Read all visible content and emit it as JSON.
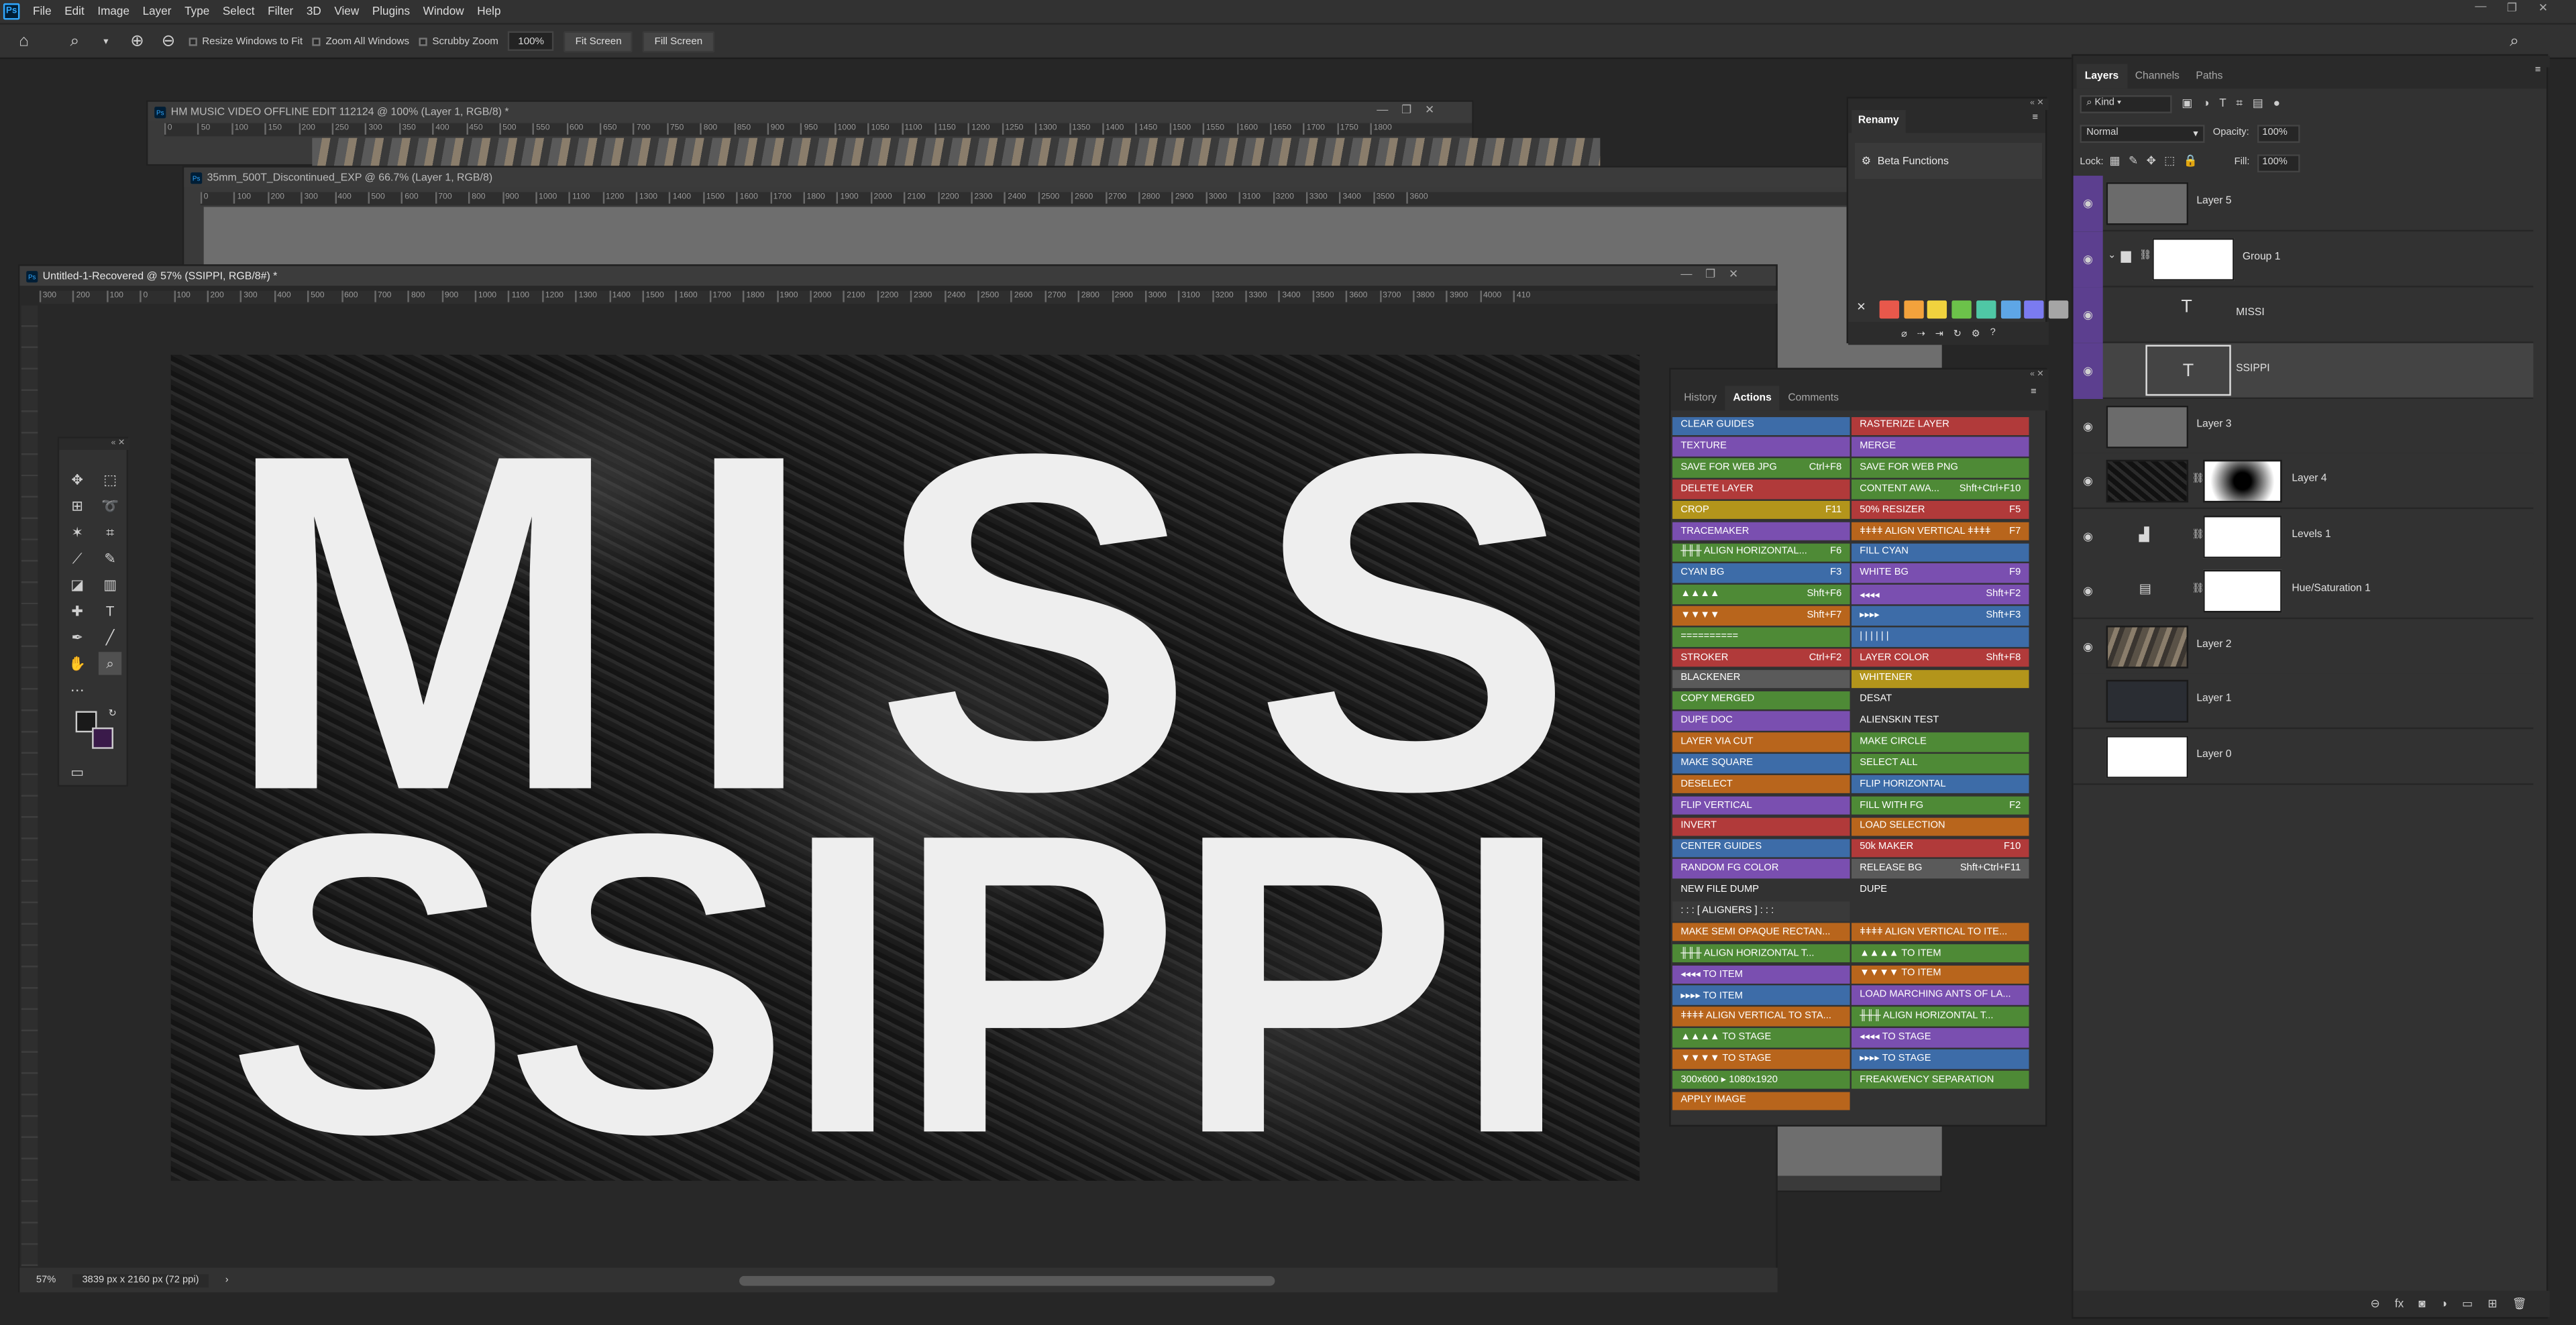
{
  "menubar": {
    "items": [
      "File",
      "Edit",
      "Image",
      "Layer",
      "Type",
      "Select",
      "Filter",
      "3D",
      "View",
      "Plugins",
      "Window",
      "Help"
    ]
  },
  "options": {
    "resize_windows": "Resize Windows to Fit",
    "zoom_all": "Zoom All Windows",
    "scrubby": "Scrubby Zoom",
    "zoom_value": "100%",
    "fit_screen": "Fit Screen",
    "fill_screen": "Fill Screen"
  },
  "docs": {
    "doc1_title": "HM MUSIC VIDEO OFFLINE EDIT 112124 @ 100% (Layer 1, RGB/8) *",
    "doc2_title": "35mm_500T_Discontinued_EXP @ 66.7% (Layer 1, RGB/8)",
    "doc3_title": "Untitled-1-Recovered @ 57% (SSIPPI, RGB/8#) *",
    "ruler1": [
      "0",
      "50",
      "100",
      "150",
      "200",
      "250",
      "300",
      "350",
      "400",
      "450",
      "500",
      "550",
      "600",
      "650",
      "700",
      "750",
      "800",
      "850",
      "900",
      "950",
      "1000",
      "1050",
      "1100",
      "1150",
      "1200",
      "1250",
      "1300",
      "1350",
      "1400",
      "1450",
      "1500",
      "1550",
      "1600",
      "1650",
      "1700",
      "1750",
      "1800"
    ],
    "ruler2": [
      "0",
      "100",
      "200",
      "300",
      "400",
      "500",
      "600",
      "700",
      "800",
      "900",
      "1000",
      "1100",
      "1200",
      "1300",
      "1400",
      "1500",
      "1600",
      "1700",
      "1800",
      "1900",
      "2000",
      "2100",
      "2200",
      "2300",
      "2400",
      "2500",
      "2600",
      "2700",
      "2800",
      "2900",
      "3000",
      "3100",
      "3200",
      "3300",
      "3400",
      "3500",
      "3600"
    ],
    "ruler3": [
      "300",
      "200",
      "100",
      "0",
      "100",
      "200",
      "300",
      "400",
      "500",
      "600",
      "700",
      "800",
      "900",
      "1000",
      "1100",
      "1200",
      "1300",
      "1400",
      "1500",
      "1600",
      "1700",
      "1800",
      "1900",
      "2000",
      "2100",
      "2200",
      "2300",
      "2400",
      "2500",
      "2600",
      "2700",
      "2800",
      "2900",
      "3000",
      "3100",
      "3200",
      "3300",
      "3400",
      "3500",
      "3600",
      "3700",
      "3800",
      "3900",
      "4000",
      "410"
    ],
    "line1": "MISSI",
    "line2": "SSIPPI",
    "zoom": "57%",
    "dims": "3839 px x 2160 px (72 ppi)"
  },
  "renamy": {
    "title": "Renamy",
    "beta": "Beta Functions",
    "swatches": [
      "#e8584b",
      "#f2a23c",
      "#f0d23e",
      "#6cc24a",
      "#4fc7a5",
      "#5ea6e6",
      "#7b7bf0",
      "#a5a5a5"
    ]
  },
  "actions_panel": {
    "tabs": [
      "History",
      "Actions",
      "Comments"
    ],
    "left": [
      {
        "label": "CLEAR GUIDES",
        "key": "",
        "color": "#3d6ca8"
      },
      {
        "label": "TEXTURE",
        "key": "",
        "color": "#7a4fb0"
      },
      {
        "label": "SAVE FOR WEB JPG",
        "key": "Ctrl+F8",
        "color": "#4e8a36"
      },
      {
        "label": "DELETE LAYER",
        "key": "",
        "color": "#b13a3a"
      },
      {
        "label": "CROP",
        "key": "F11",
        "color": "#b3951b"
      },
      {
        "label": "TRACEMAKER",
        "key": "",
        "color": "#7a4fb0"
      },
      {
        "label": "╫╫╫ ALIGN HORIZONTAL...",
        "key": "F6",
        "color": "#4e8a36"
      },
      {
        "label": "CYAN BG",
        "key": "F3",
        "color": "#3d6ca8"
      },
      {
        "label": "▲▲▲▲",
        "key": "Shft+F6",
        "color": "#4e8a36"
      },
      {
        "label": "▼▼▼▼",
        "key": "Shft+F7",
        "color": "#b8651c"
      },
      {
        "label": "==========",
        "key": "",
        "color": "#4e8a36"
      },
      {
        "label": "STROKER",
        "key": "Ctrl+F2",
        "color": "#b13a3a"
      },
      {
        "label": "BLACKENER",
        "key": "",
        "color": "#5a5a5a"
      },
      {
        "label": "COPY MERGED",
        "key": "",
        "color": "#4e8a36"
      },
      {
        "label": "DUPE DOC",
        "key": "",
        "color": "#7a4fb0"
      },
      {
        "label": "LAYER VIA CUT",
        "key": "",
        "color": "#b8651c"
      },
      {
        "label": "MAKE SQUARE",
        "key": "",
        "color": "#3d6ca8"
      },
      {
        "label": "DESELECT",
        "key": "",
        "color": "#b8651c"
      },
      {
        "label": "FLIP VERTICAL",
        "key": "",
        "color": "#7a4fb0"
      },
      {
        "label": "INVERT",
        "key": "",
        "color": "#b13a3a"
      },
      {
        "label": "CENTER GUIDES",
        "key": "",
        "color": "#3d6ca8"
      },
      {
        "label": "RANDOM FG COLOR",
        "key": "",
        "color": "#7a4fb0"
      },
      {
        "label": "NEW FILE DUMP",
        "key": "",
        "color": "#323232"
      },
      {
        "label": ": : : [ ALIGNERS ] : : :",
        "key": "",
        "color": "#3a3a3a"
      },
      {
        "label": "MAKE SEMI OPAQUE RECTAN...",
        "key": "",
        "color": "#b8651c"
      },
      {
        "label": "╫╫╫ ALIGN HORIZONTAL T...",
        "key": "",
        "color": "#4e8a36"
      },
      {
        "label": "◂◂◂◂ TO ITEM",
        "key": "",
        "color": "#7a4fb0"
      },
      {
        "label": "▸▸▸▸ TO ITEM",
        "key": "",
        "color": "#3d6ca8"
      },
      {
        "label": "ǂǂǂǂ ALIGN VERTICAL TO STA...",
        "key": "",
        "color": "#b8651c"
      },
      {
        "label": "▲▲▲▲ TO STAGE",
        "key": "",
        "color": "#4e8a36"
      },
      {
        "label": "▼▼▼▼ TO STAGE",
        "key": "",
        "color": "#b8651c"
      },
      {
        "label": "300x600 ▸ 1080x1920",
        "key": "",
        "color": "#4e8a36"
      },
      {
        "label": "APPLY IMAGE",
        "key": "",
        "color": "#b8651c"
      }
    ],
    "right": [
      {
        "label": "RASTERIZE LAYER",
        "key": "",
        "color": "#b13a3a"
      },
      {
        "label": "MERGE",
        "key": "",
        "color": "#7a4fb0"
      },
      {
        "label": "SAVE FOR WEB PNG",
        "key": "",
        "color": "#4e8a36"
      },
      {
        "label": "CONTENT AWA...",
        "key": "Shft+Ctrl+F10",
        "color": "#4e8a36"
      },
      {
        "label": "50% RESIZER",
        "key": "F5",
        "color": "#b13a3a"
      },
      {
        "label": "ǂǂǂǂ ALIGN VERTICAL ǂǂǂǂ",
        "key": "F7",
        "color": "#b8651c"
      },
      {
        "label": "FILL CYAN",
        "key": "",
        "color": "#3d6ca8"
      },
      {
        "label": "WHITE BG",
        "key": "F9",
        "color": "#7a4fb0"
      },
      {
        "label": "◂◂◂◂",
        "key": "Shft+F2",
        "color": "#7a4fb0"
      },
      {
        "label": "▸▸▸▸",
        "key": "Shft+F3",
        "color": "#3d6ca8"
      },
      {
        "label": "| | | | | |",
        "key": "",
        "color": "#3d6ca8"
      },
      {
        "label": "LAYER COLOR",
        "key": "Shft+F8",
        "color": "#b13a3a"
      },
      {
        "label": "WHITENER",
        "key": "",
        "color": "#b3951b"
      },
      {
        "label": "DESAT",
        "key": "",
        "color": "#323232"
      },
      {
        "label": "ALIENSKIN TEST",
        "key": "",
        "color": "#323232"
      },
      {
        "label": "MAKE CIRCLE",
        "key": "",
        "color": "#4e8a36"
      },
      {
        "label": "SELECT ALL",
        "key": "",
        "color": "#4e8a36"
      },
      {
        "label": "FLIP HORIZONTAL",
        "key": "",
        "color": "#3d6ca8"
      },
      {
        "label": "FILL WITH FG",
        "key": "F2",
        "color": "#4e8a36"
      },
      {
        "label": "LOAD SELECTION",
        "key": "",
        "color": "#b8651c"
      },
      {
        "label": "50k MAKER",
        "key": "F10",
        "color": "#b13a3a"
      },
      {
        "label": "RELEASE BG",
        "key": "Shft+Ctrl+F11",
        "color": "#5a5a5a"
      },
      {
        "label": "DUPE",
        "key": "",
        "color": "#323232"
      },
      {
        "label": "",
        "key": "",
        "color": "#323232"
      },
      {
        "label": "ǂǂǂǂ ALIGN VERTICAL TO ITE...",
        "key": "",
        "color": "#b8651c"
      },
      {
        "label": "▲▲▲▲ TO ITEM",
        "key": "",
        "color": "#4e8a36"
      },
      {
        "label": "▼▼▼▼ TO ITEM",
        "key": "",
        "color": "#b8651c"
      },
      {
        "label": "LOAD MARCHING ANTS OF LA...",
        "key": "",
        "color": "#7a4fb0"
      },
      {
        "label": "╫╫╫ ALIGN HORIZONTAL T...",
        "key": "",
        "color": "#4e8a36"
      },
      {
        "label": "◂◂◂◂ TO STAGE",
        "key": "",
        "color": "#7a4fb0"
      },
      {
        "label": "▸▸▸▸ TO STAGE",
        "key": "",
        "color": "#3d6ca8"
      },
      {
        "label": "FREAKWENCY SEPARATION",
        "key": "",
        "color": "#4e8a36"
      }
    ]
  },
  "layers_panel": {
    "tabs": [
      "Layers",
      "Channels",
      "Paths"
    ],
    "kind": "Kind",
    "blend": "Normal",
    "opacity_label": "Opacity:",
    "opacity": "100%",
    "lock_label": "Lock:",
    "fill_label": "Fill:",
    "fill": "100%",
    "layers": [
      {
        "name": "Layer 5",
        "purple": true
      },
      {
        "name": "Group 1",
        "purple": true
      },
      {
        "name": "MISSI",
        "purple": true
      },
      {
        "name": "SSIPPI",
        "purple": true
      },
      {
        "name": "Layer 3",
        "purple": false
      },
      {
        "name": "Layer 4",
        "purple": false
      },
      {
        "name": "Levels 1",
        "purple": false
      },
      {
        "name": "Hue/Saturation 1",
        "purple": false
      },
      {
        "name": "Layer 2",
        "purple": false
      },
      {
        "name": "Layer 1",
        "purple": false
      },
      {
        "name": "Layer 0",
        "purple": false
      }
    ]
  }
}
